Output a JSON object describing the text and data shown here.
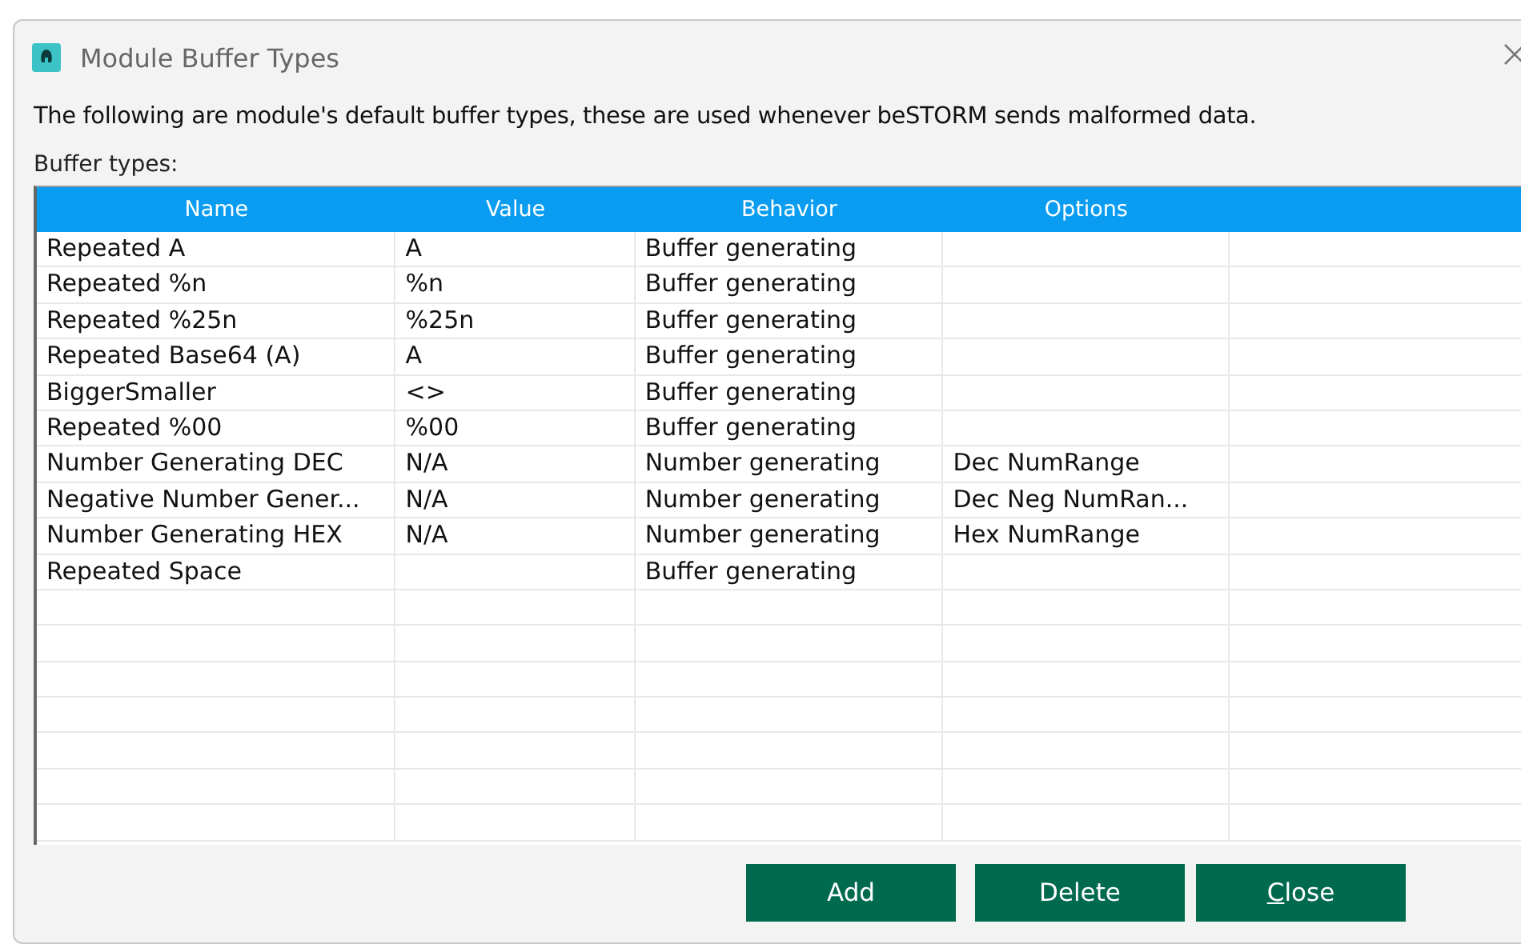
{
  "window": {
    "title": "Module Buffer Types"
  },
  "description": "The following are module's default buffer types, these are used whenever beSTORM sends malformed data.",
  "table_label": "Buffer types:",
  "table": {
    "columns": [
      "Name",
      "Value",
      "Behavior",
      "Options"
    ],
    "rows": [
      [
        "Repeated A",
        "A",
        "Buffer generating",
        ""
      ],
      [
        "Repeated %n",
        "%n",
        "Buffer generating",
        ""
      ],
      [
        "Repeated %25n",
        "%25n",
        "Buffer generating",
        ""
      ],
      [
        "Repeated Base64 (A)",
        "A",
        "Buffer generating",
        ""
      ],
      [
        "BiggerSmaller",
        "<>",
        "Buffer generating",
        ""
      ],
      [
        "Repeated %00",
        "%00",
        "Buffer generating",
        ""
      ],
      [
        "Number Generating DEC",
        "N/A",
        "Number generating",
        "Dec NumRange"
      ],
      [
        "Negative Number Gener...",
        "N/A",
        "Number generating",
        "Dec Neg NumRan..."
      ],
      [
        "Number Generating HEX",
        "N/A",
        "Number generating",
        "Hex NumRange"
      ],
      [
        "Repeated Space",
        "",
        "Buffer generating",
        ""
      ]
    ]
  },
  "buttons": [
    "Add",
    "Delete",
    "Close"
  ]
}
